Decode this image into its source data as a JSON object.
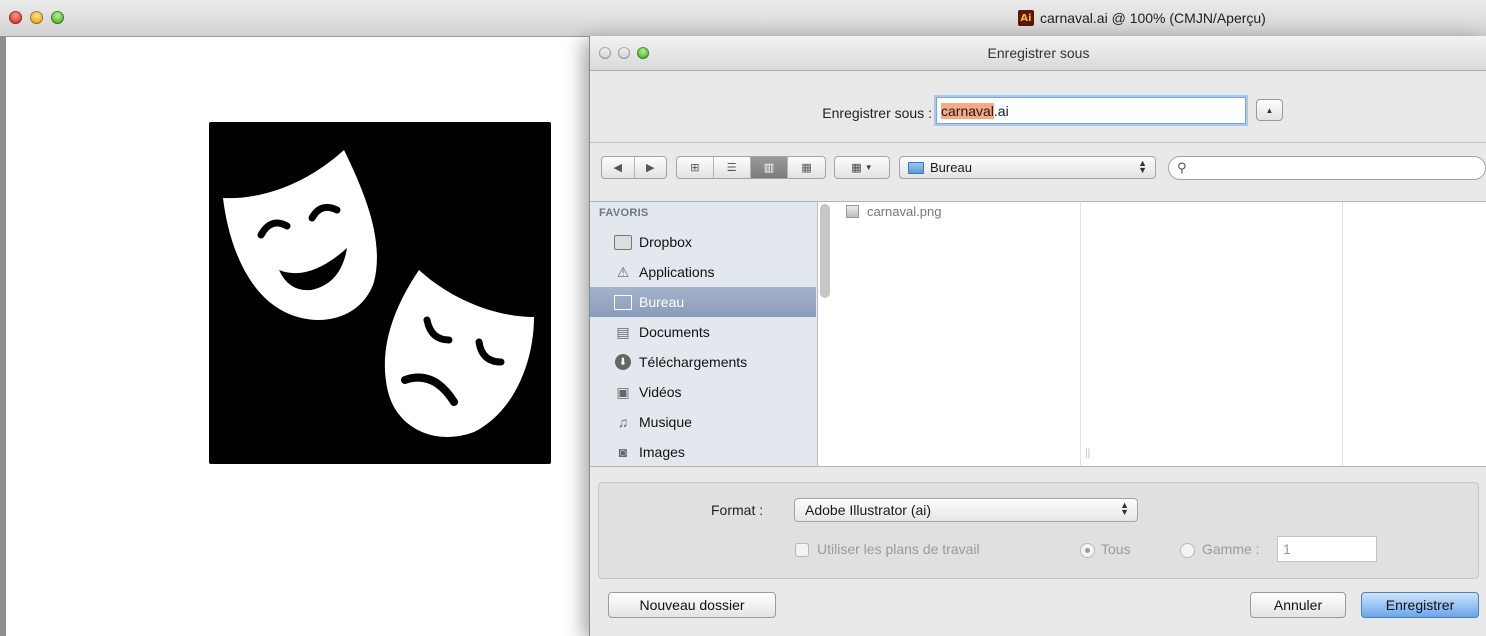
{
  "main_window": {
    "title": "carnaval.ai @ 100% (CMJN/Aperçu)",
    "app_icon_text": "Ai"
  },
  "artwork": {
    "description_icon": "theatre-masks-icon",
    "colors": {
      "background": "#000000",
      "masks": "#ffffff"
    }
  },
  "dialog": {
    "title": "Enregistrer sous",
    "save_as_label": "Enregistrer sous :",
    "filename_selected": "carnaval",
    "filename_extension": ".ai",
    "toolbar": {
      "back_icon": "◀",
      "forward_icon": "▶",
      "location": "Bureau",
      "search_placeholder": ""
    },
    "sidebar": {
      "header": "FAVORIS",
      "items": [
        {
          "label": "Dropbox",
          "icon": "folder-icon"
        },
        {
          "label": "Applications",
          "icon": "applications-icon"
        },
        {
          "label": "Bureau",
          "icon": "desktop-icon",
          "selected": true
        },
        {
          "label": "Documents",
          "icon": "documents-icon"
        },
        {
          "label": "Téléchargements",
          "icon": "downloads-icon"
        },
        {
          "label": "Vidéos",
          "icon": "movies-icon"
        },
        {
          "label": "Musique",
          "icon": "music-icon"
        },
        {
          "label": "Images",
          "icon": "pictures-icon"
        }
      ]
    },
    "files": [
      {
        "name": "carnaval.png"
      }
    ],
    "options": {
      "format_label": "Format :",
      "format_value": "Adobe Illustrator (ai)",
      "artboards_label": "Utiliser les plans de travail",
      "all_label": "Tous",
      "range_label": "Gamme :",
      "range_value": "1"
    },
    "buttons": {
      "new_folder": "Nouveau dossier",
      "cancel": "Annuler",
      "save": "Enregistrer"
    },
    "colors": {
      "selection": "#f7a986",
      "sidebar_selected": "#8a9cbc",
      "default_button": "#6aa6ea"
    }
  }
}
